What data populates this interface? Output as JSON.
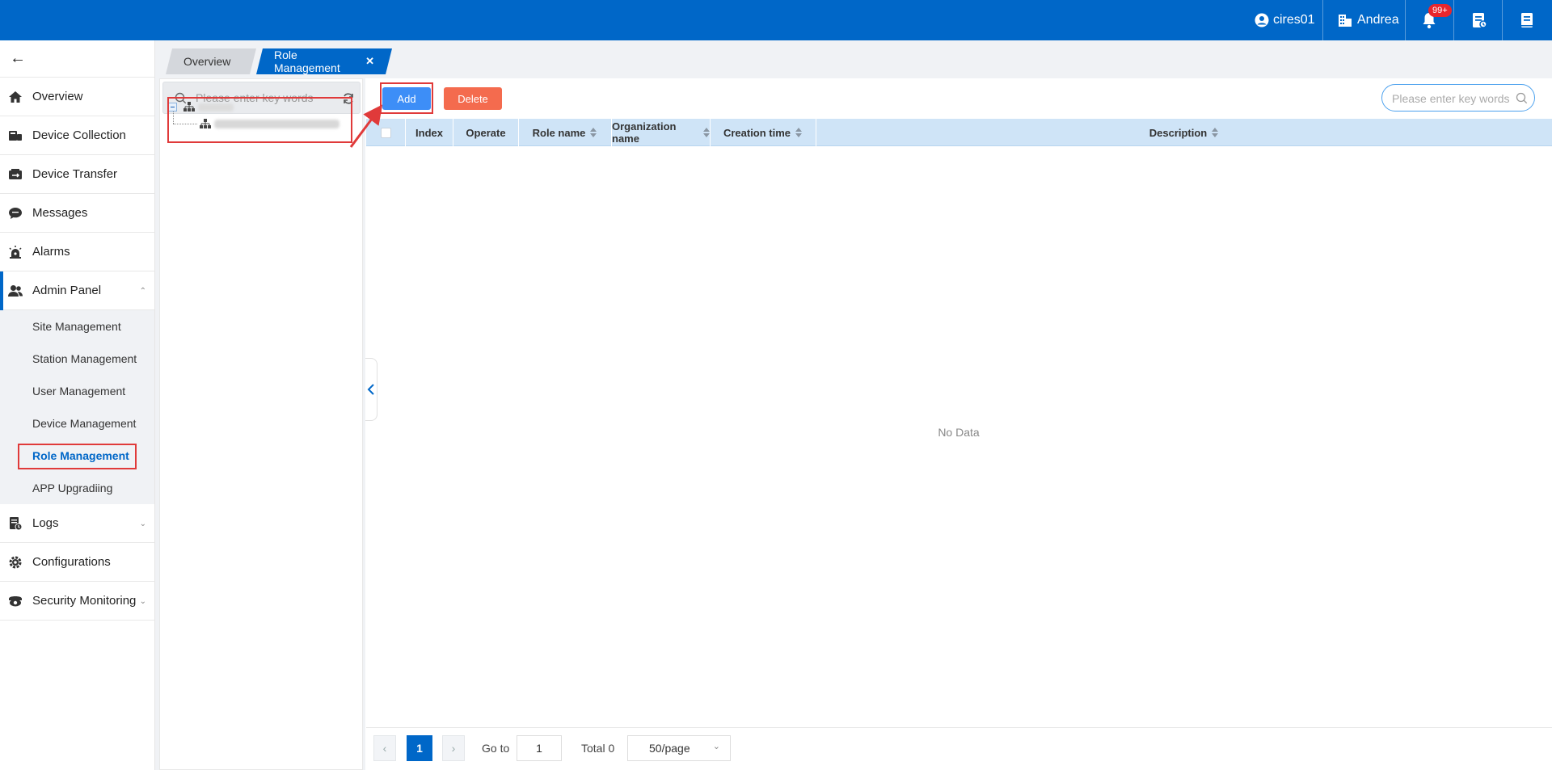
{
  "topbar": {
    "user_name": "cires01",
    "org_name": "Andrea",
    "notification_count": "99+",
    "bg_color": "#0067c8"
  },
  "sidebar": {
    "back_icon": "arrow-left-icon",
    "items": [
      {
        "label": "Overview",
        "icon": "home-icon"
      },
      {
        "label": "Device Collection",
        "icon": "device-collection-icon"
      },
      {
        "label": "Device Transfer",
        "icon": "device-transfer-icon"
      },
      {
        "label": "Messages",
        "icon": "chat-icon"
      },
      {
        "label": "Alarms",
        "icon": "alarm-icon"
      },
      {
        "label": "Admin Panel",
        "icon": "users-icon"
      },
      {
        "label": "Logs",
        "icon": "logs-icon"
      },
      {
        "label": "Configurations",
        "icon": "gear-icon"
      },
      {
        "label": "Security Monitoring",
        "icon": "camera-icon"
      }
    ],
    "admin_sub": [
      {
        "label": "Site Management"
      },
      {
        "label": "Station Management"
      },
      {
        "label": "User Management"
      },
      {
        "label": "Device Management"
      },
      {
        "label": "Role Management"
      },
      {
        "label": "APP Upgradiing"
      }
    ]
  },
  "tabs": [
    {
      "label": "Overview"
    },
    {
      "label": "Role Management"
    }
  ],
  "tree": {
    "search_placeholder": "Please enter key words"
  },
  "toolbar": {
    "add_label": "Add",
    "delete_label": "Delete",
    "search_placeholder": "Please enter key words",
    "add_color": "#3d8ef7",
    "delete_color": "#f46b4e"
  },
  "table": {
    "columns": [
      "Index",
      "Operate",
      "Role name",
      "Organization name",
      "Creation time",
      "Description"
    ],
    "empty_text": "No Data"
  },
  "pagination": {
    "current_page": "1",
    "goto_label": "Go to",
    "goto_value": "1",
    "total_label": "Total 0",
    "page_size": "50/page"
  }
}
